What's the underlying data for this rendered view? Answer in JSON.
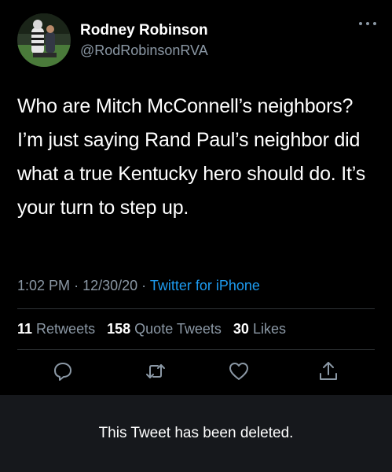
{
  "tweet": {
    "author": {
      "display_name": "Rodney Robinson",
      "handle": "@RodRobinsonRVA"
    },
    "text": "Who are Mitch McConnell’s neighbors? I’m just saying Rand Paul’s neighbor did what a true Kentucky hero should do. It’s your turn to step up.",
    "time": "1:02 PM",
    "date": "12/30/20",
    "separator": "·",
    "source": "Twitter for iPhone",
    "stats": {
      "retweets_count": "11",
      "retweets_label": "Retweets",
      "quotes_count": "158",
      "quotes_label": "Quote Tweets",
      "likes_count": "30",
      "likes_label": "Likes"
    },
    "actions": {
      "reply_icon": "reply-icon",
      "retweet_icon": "retweet-icon",
      "like_icon": "heart-icon",
      "share_icon": "share-icon"
    }
  },
  "deleted_banner": {
    "text": "This Tweet has been deleted."
  },
  "colors": {
    "background": "#000000",
    "text_primary": "#ffffff",
    "text_secondary": "#8b98a5",
    "link": "#1d9bf0",
    "divider": "#2f3336",
    "banner_bg": "#16181c"
  }
}
